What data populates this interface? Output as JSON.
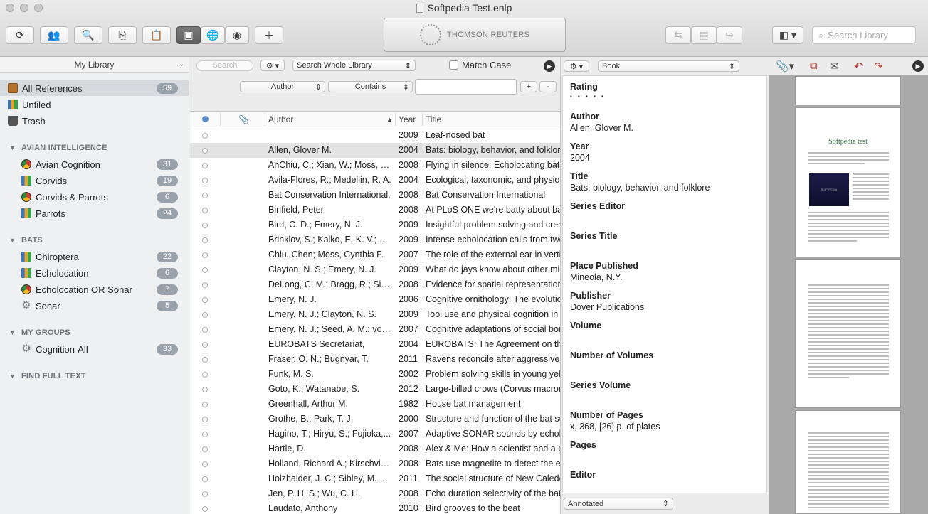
{
  "window": {
    "title": "Softpedia Test.enlp"
  },
  "toolbar": {
    "brand": "THOMSON REUTERS",
    "search_placeholder": "Search Library"
  },
  "sidebar": {
    "library_select": "My Library",
    "items": [
      {
        "label": "All References",
        "count": "59",
        "icon": "all-references-icon",
        "selected": true
      },
      {
        "label": "Unfiled",
        "count": "",
        "icon": "unfiled-group-icon"
      },
      {
        "label": "Trash",
        "count": "",
        "icon": "trash-icon"
      }
    ],
    "sections": [
      {
        "heading": "AVIAN INTELLIGENCE",
        "items": [
          {
            "label": "Avian Cognition",
            "count": "31",
            "icon": "smart-group-icon"
          },
          {
            "label": "Corvids",
            "count": "19",
            "icon": "group-icon"
          },
          {
            "label": "Corvids & Parrots",
            "count": "6",
            "icon": "smart-group-icon"
          },
          {
            "label": "Parrots",
            "count": "24",
            "icon": "group-icon"
          }
        ]
      },
      {
        "heading": "BATS",
        "items": [
          {
            "label": "Chiroptera",
            "count": "22",
            "icon": "group-icon"
          },
          {
            "label": "Echolocation",
            "count": "6",
            "icon": "group-icon"
          },
          {
            "label": "Echolocation OR Sonar",
            "count": "7",
            "icon": "smart-group-icon"
          },
          {
            "label": "Sonar",
            "count": "5",
            "icon": "gear-icon"
          }
        ]
      },
      {
        "heading": "MY GROUPS",
        "items": [
          {
            "label": "Cognition-All",
            "count": "33",
            "icon": "gear-icon"
          }
        ]
      },
      {
        "heading": "FIND FULL TEXT",
        "items": []
      }
    ]
  },
  "search_panel": {
    "quick_search_placeholder": "Search",
    "scope": "Search Whole Library",
    "match_case": "Match Case",
    "field": "Author",
    "operator": "Contains",
    "add": "+",
    "remove": "-"
  },
  "list": {
    "columns": [
      "Author",
      "Year",
      "Title"
    ],
    "rows": [
      {
        "author": "",
        "year": "2009",
        "title": "Leaf-nosed bat"
      },
      {
        "author": "Allen, Glover M.",
        "year": "2004",
        "title": "Bats: biology, behavior, and folklore",
        "selected": true
      },
      {
        "author": "AnChiu, C.; Xian, W.; Moss, C. F.",
        "year": "2008",
        "title": "Flying in silence: Echolocating bats"
      },
      {
        "author": "Avila-Flores, R.; Medellin, R. A.",
        "year": "2004",
        "title": "Ecological, taxonomic, and physiological"
      },
      {
        "author": "Bat Conservation International,",
        "year": "2008",
        "title": "Bat Conservation International"
      },
      {
        "author": "Binfield, Peter",
        "year": "2008",
        "title": "At PLoS ONE we're batty about bats"
      },
      {
        "author": "Bird, C. D.; Emery, N. J.",
        "year": "2009",
        "title": "Insightful problem solving and creative"
      },
      {
        "author": "Brinklov, S.; Kalko, E. K. V.; Su...",
        "year": "2009",
        "title": "Intense echolocation calls from two"
      },
      {
        "author": "Chiu, Chen; Moss, Cynthia F.",
        "year": "2007",
        "title": "The role of the external ear in vertical"
      },
      {
        "author": "Clayton, N. S.; Emery, N. J.",
        "year": "2009",
        "title": "What do jays know about other minds"
      },
      {
        "author": "DeLong, C. M.; Bragg, R.; Sim...",
        "year": "2008",
        "title": "Evidence for spatial representation"
      },
      {
        "author": "Emery, N. J.",
        "year": "2006",
        "title": "Cognitive ornithology: The evolution"
      },
      {
        "author": "Emery, N. J.; Clayton, N. S.",
        "year": "2009",
        "title": "Tool use and physical cognition in"
      },
      {
        "author": "Emery, N. J.; Seed, A. M.; von...",
        "year": "2007",
        "title": "Cognitive adaptations of social bonding"
      },
      {
        "author": "EUROBATS Secretariat,",
        "year": "2004",
        "title": "EUROBATS: The Agreement on the"
      },
      {
        "author": "Fraser, O. N.; Bugnyar, T.",
        "year": "2011",
        "title": "Ravens reconcile after aggressive"
      },
      {
        "author": "Funk, M. S.",
        "year": "2002",
        "title": "Problem solving skills in young yellow"
      },
      {
        "author": "Goto, K.; Watanabe, S.",
        "year": "2012",
        "title": "Large-billed crows (Corvus macrorhynchos"
      },
      {
        "author": "Greenhall, Arthur M.",
        "year": "1982",
        "title": "House bat management"
      },
      {
        "author": "Grothe, B.; Park, T. J.",
        "year": "2000",
        "title": "Structure and function of the bat superior"
      },
      {
        "author": "Hagino, T.; Hiryu, S.; Fujioka,...",
        "year": "2007",
        "title": "Adaptive SONAR sounds by echolocating"
      },
      {
        "author": "Hartle, D.",
        "year": "2008",
        "title": "Alex & Me: How a scientist and a parrot"
      },
      {
        "author": "Holland, Richard A.; Kirschvin...",
        "year": "2008",
        "title": "Bats use magnetite to detect the earth"
      },
      {
        "author": "Holzhaider, J. C.; Sibley, M. D....",
        "year": "2011",
        "title": "The social structure of New Caledonian"
      },
      {
        "author": "Jen, P. H. S.; Wu, C. H.",
        "year": "2008",
        "title": "Echo duration selectivity of the bat"
      },
      {
        "author": "Laudato, Anthony",
        "year": "2010",
        "title": "Bird grooves to the beat"
      }
    ]
  },
  "details": {
    "ref_type": "Book",
    "fields": [
      {
        "label": "Rating",
        "value": ""
      },
      {
        "label": "Author",
        "value": "Allen, Glover M."
      },
      {
        "label": "Year",
        "value": "2004"
      },
      {
        "label": "Title",
        "value": "Bats: biology, behavior, and folklore"
      },
      {
        "label": "Series Editor",
        "value": ""
      },
      {
        "label": "Series Title",
        "value": ""
      },
      {
        "label": "Place Published",
        "value": "Mineola, N.Y."
      },
      {
        "label": "Publisher",
        "value": "Dover Publications"
      },
      {
        "label": "Volume",
        "value": ""
      },
      {
        "label": "Number of Volumes",
        "value": ""
      },
      {
        "label": "Series Volume",
        "value": ""
      },
      {
        "label": "Number of Pages",
        "value": "x, 368, [26] p. of plates"
      },
      {
        "label": "Pages",
        "value": ""
      },
      {
        "label": "Editor",
        "value": ""
      }
    ],
    "view_mode": "Annotated"
  },
  "pdf": {
    "page_title": "Softpedia test",
    "image_text": "SOFTPEDIA"
  }
}
